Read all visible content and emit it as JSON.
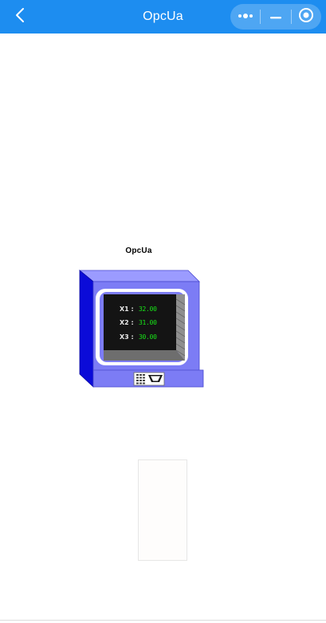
{
  "navbar": {
    "title": "OpcUa",
    "background": "#1d8df0",
    "back_icon": "chevron-left-icon",
    "capsule": {
      "more_icon": "more-dots-icon",
      "minimize_icon": "minimize-icon",
      "close_icon": "target-close-icon"
    }
  },
  "widget": {
    "title": "OpcUa",
    "device_icon": "terminal-monitor-icon",
    "colors": {
      "housing": "#7c7cf5",
      "housing_side": "#0b0bd8",
      "screen": "#141414",
      "digits": "#17e617"
    },
    "readouts": [
      {
        "label": "X1 :",
        "value": "32.00"
      },
      {
        "label": "X2 :",
        "value": "31.00"
      },
      {
        "label": "X3 :",
        "value": "30.00"
      }
    ]
  }
}
